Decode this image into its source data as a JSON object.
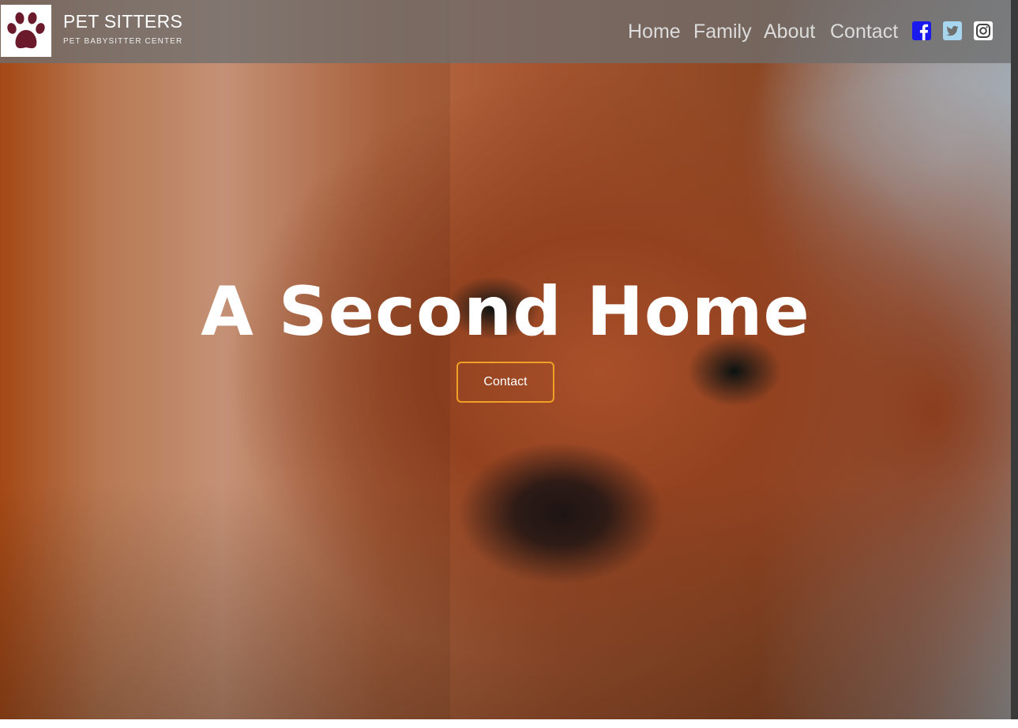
{
  "brand": {
    "title": "PET SITTERS",
    "subtitle": "PET BABYSITTER CENTER",
    "logo_icon": "paw-icon",
    "logo_color": "#6b1a2c"
  },
  "nav": {
    "items": [
      {
        "label": "Home"
      },
      {
        "label": "Family"
      },
      {
        "label": "About"
      },
      {
        "label": "Contact"
      }
    ],
    "social": [
      {
        "icon": "facebook-icon",
        "color": "#1a1aee"
      },
      {
        "icon": "twitter-icon",
        "color": "#a8d6ee"
      },
      {
        "icon": "instagram-icon",
        "color": "#ffffff"
      }
    ]
  },
  "hero": {
    "headline": "A Second Home",
    "cta_label": "Contact",
    "cta_border_color": "#f0a024",
    "background_image": "puppy-photo"
  }
}
